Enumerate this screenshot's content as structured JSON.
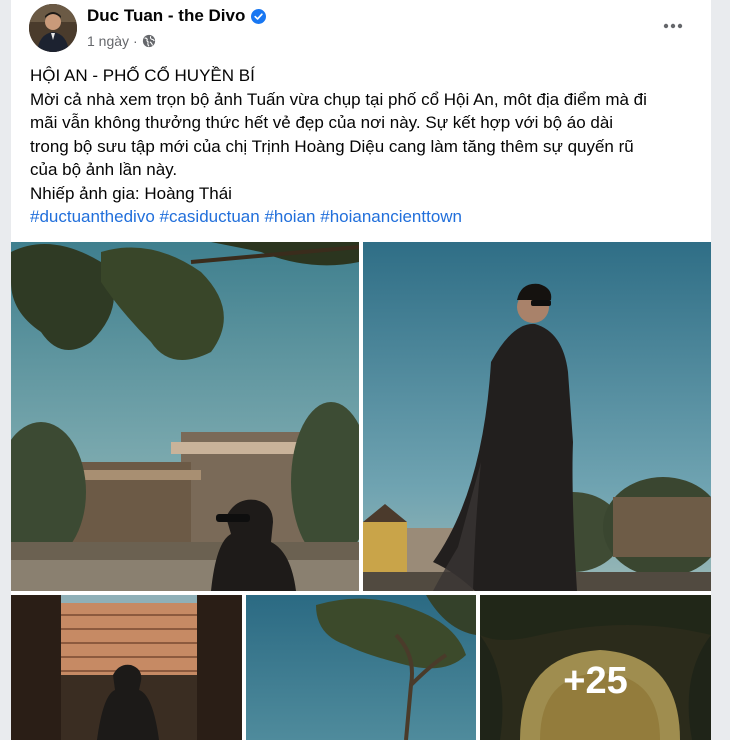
{
  "post": {
    "author": "Duc Tuan - the Divo",
    "time": "1 ngày",
    "separator": "·",
    "text_lines": [
      "HỘI AN - PHỐ CỔ HUYỀN BÍ",
      "Mời cả nhà xem trọn bộ ảnh Tuấn vừa chụp tại phố cổ Hội An, môt địa điểm mà đi",
      "mãi vẫn không thưởng thức hết vẻ đẹp của nơi này. Sự kết hợp với bộ áo dài",
      "trong bộ sưu tập mới của chị Trịnh Hoàng Diệu cang làm tăng thêm sự quyến rũ",
      "của bộ ảnh lần này.",
      "Nhiếp ảnh gia: Hoàng Thái"
    ],
    "hashtags": [
      "#ductuanthedivo",
      "#casiductuan",
      "#hoian",
      "#hoianancienttown"
    ],
    "more_photos": "+25"
  },
  "icons": {
    "verified": "verified-badge-icon",
    "audience": "globe-icon",
    "options": "more-options-icon"
  },
  "colors": {
    "link": "#216fdb",
    "verified": "#1877f2",
    "secondary_text": "#65676b"
  }
}
